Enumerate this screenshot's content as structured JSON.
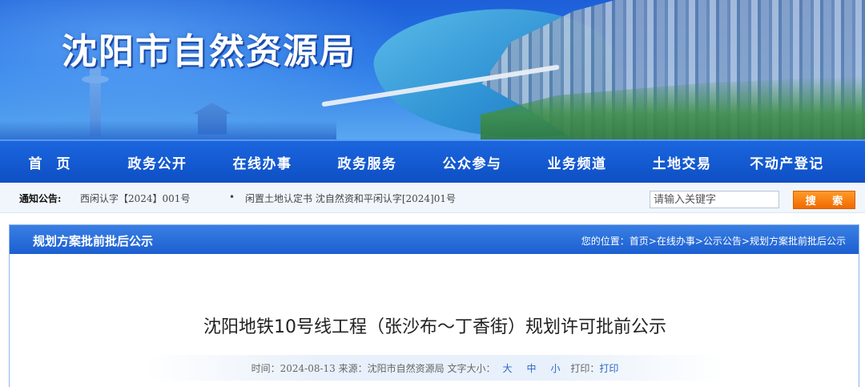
{
  "site": {
    "title": "沈阳市自然资源局"
  },
  "nav": {
    "items": [
      {
        "label": "首页"
      },
      {
        "label": "政务公开"
      },
      {
        "label": "在线办事"
      },
      {
        "label": "政务服务"
      },
      {
        "label": "公众参与"
      },
      {
        "label": "业务频道"
      },
      {
        "label": "土地交易"
      },
      {
        "label": "不动产登记"
      }
    ]
  },
  "notice": {
    "label": "通知公告:",
    "messages": [
      "西闲认字【2024】001号",
      "闲置土地认定书 沈自然资和平闲认字[2024]01号"
    ],
    "bullet": "•"
  },
  "search": {
    "placeholder": "请输入关键字",
    "button_label": "搜 索"
  },
  "panel": {
    "title": "规划方案批前批后公示",
    "breadcrumb": {
      "prefix": "您的位置：",
      "items": [
        "首页",
        "在线办事",
        "公示公告",
        "规划方案批前批后公示"
      ],
      "separator": ">"
    }
  },
  "article": {
    "title": "沈阳地铁10号线工程（张沙布～丁香街）规划许可批前公示",
    "meta": {
      "time_label": "时间：",
      "time": "2024-08-13",
      "source_label": "来源：",
      "source": "沈阳市自然资源局",
      "font_size_label": "文字大小：",
      "font_sizes": [
        "大",
        "中",
        "小"
      ],
      "print_label": "打印：",
      "print_link": "打印"
    }
  }
}
